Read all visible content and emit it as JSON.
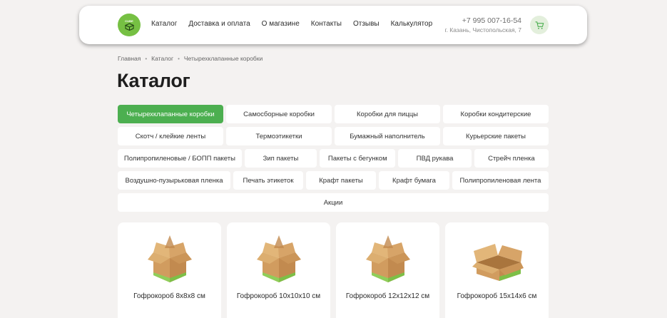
{
  "header": {
    "logo_text": "CUBE",
    "nav": [
      "Каталог",
      "Доставка и оплата",
      "О магазине",
      "Контакты",
      "Отзывы",
      "Калькулятор"
    ],
    "phone": "+7 995 007-16-54",
    "address": "г. Казань, Чистопольская, 7"
  },
  "breadcrumb": [
    "Главная",
    "Каталог",
    "Четырехклапанные коробки"
  ],
  "page_title": "Каталог",
  "categories": [
    [
      "Четырехклапанные коробки",
      "Самосборные коробки",
      "Коробки для пиццы",
      "Коробки кондитерские"
    ],
    [
      "Скотч / клейкие ленты",
      "Термоэтикетки",
      "Бумажный наполнитель",
      "Курьерские пакеты"
    ],
    [
      "Полипропиленовые / БОПП пакеты",
      "Зип пакеты",
      "Пакеты с бегунком",
      "ПВД рукава",
      "Стрейч пленка"
    ],
    [
      "Воздушно-пузырьковая пленка",
      "Печать этикеток",
      "Крафт пакеты",
      "Крафт бумага",
      "Полипропиленовая лента"
    ],
    [
      "Акции"
    ]
  ],
  "active_category": "Четырехклапанные коробки",
  "products": [
    {
      "title": "Гофрокороб 8x8x8 см",
      "icon": "cardboard-box-icon"
    },
    {
      "title": "Гофрокороб 10x10x10 см",
      "icon": "cardboard-box-icon"
    },
    {
      "title": "Гофрокороб 12x12x12 см",
      "icon": "cardboard-box-icon"
    },
    {
      "title": "Гофрокороб 15x14x6 см",
      "icon": "flat-cardboard-box-icon"
    }
  ],
  "colors": {
    "accent": "#4caf50",
    "logo": "#76c043",
    "cart_bg": "#e3efdc",
    "background": "#f4f2f1",
    "cardboard": "#d7a468"
  }
}
